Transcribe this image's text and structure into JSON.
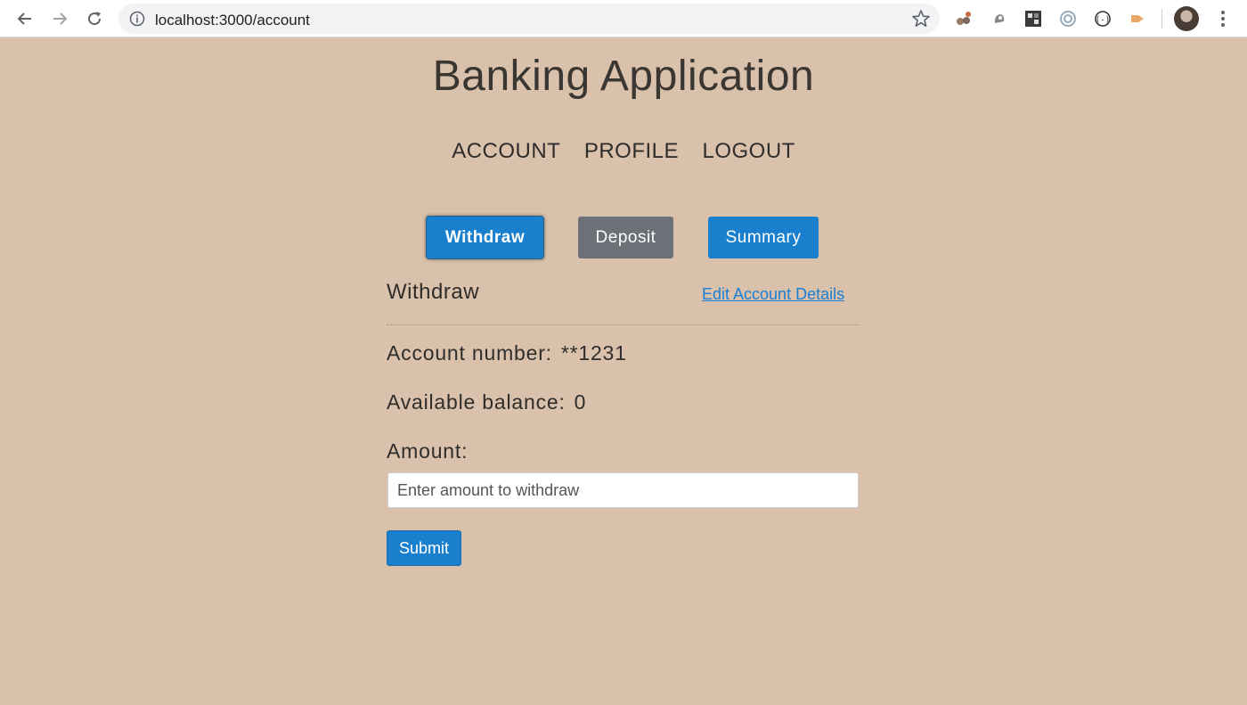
{
  "browser": {
    "url": "localhost:3000/account",
    "icons": [
      "back-arrow-icon",
      "forward-arrow-icon",
      "reload-icon",
      "info-icon",
      "star-icon",
      "extension-icon",
      "profile-avatar",
      "menu-icon"
    ]
  },
  "app": {
    "title": "Banking Application"
  },
  "nav": {
    "items": [
      {
        "label": "ACCOUNT"
      },
      {
        "label": "PROFILE"
      },
      {
        "label": "LOGOUT"
      }
    ]
  },
  "tabs": {
    "withdraw": "Withdraw",
    "deposit": "Deposit",
    "summary": "Summary",
    "active": "Withdraw"
  },
  "form": {
    "heading": "Withdraw",
    "edit_link": "Edit Account Details",
    "account_label": "Account number:",
    "account_value": "**1231",
    "balance_label": "Available balance:",
    "balance_value": "0",
    "amount_label": "Amount:",
    "amount_placeholder": "Enter amount to withdraw",
    "amount_value": "",
    "submit_label": "Submit"
  },
  "colors": {
    "page_background": "#dac1ac",
    "primary": "#1a7fcc",
    "secondary": "#6c7177",
    "link": "#1a7fd4"
  }
}
